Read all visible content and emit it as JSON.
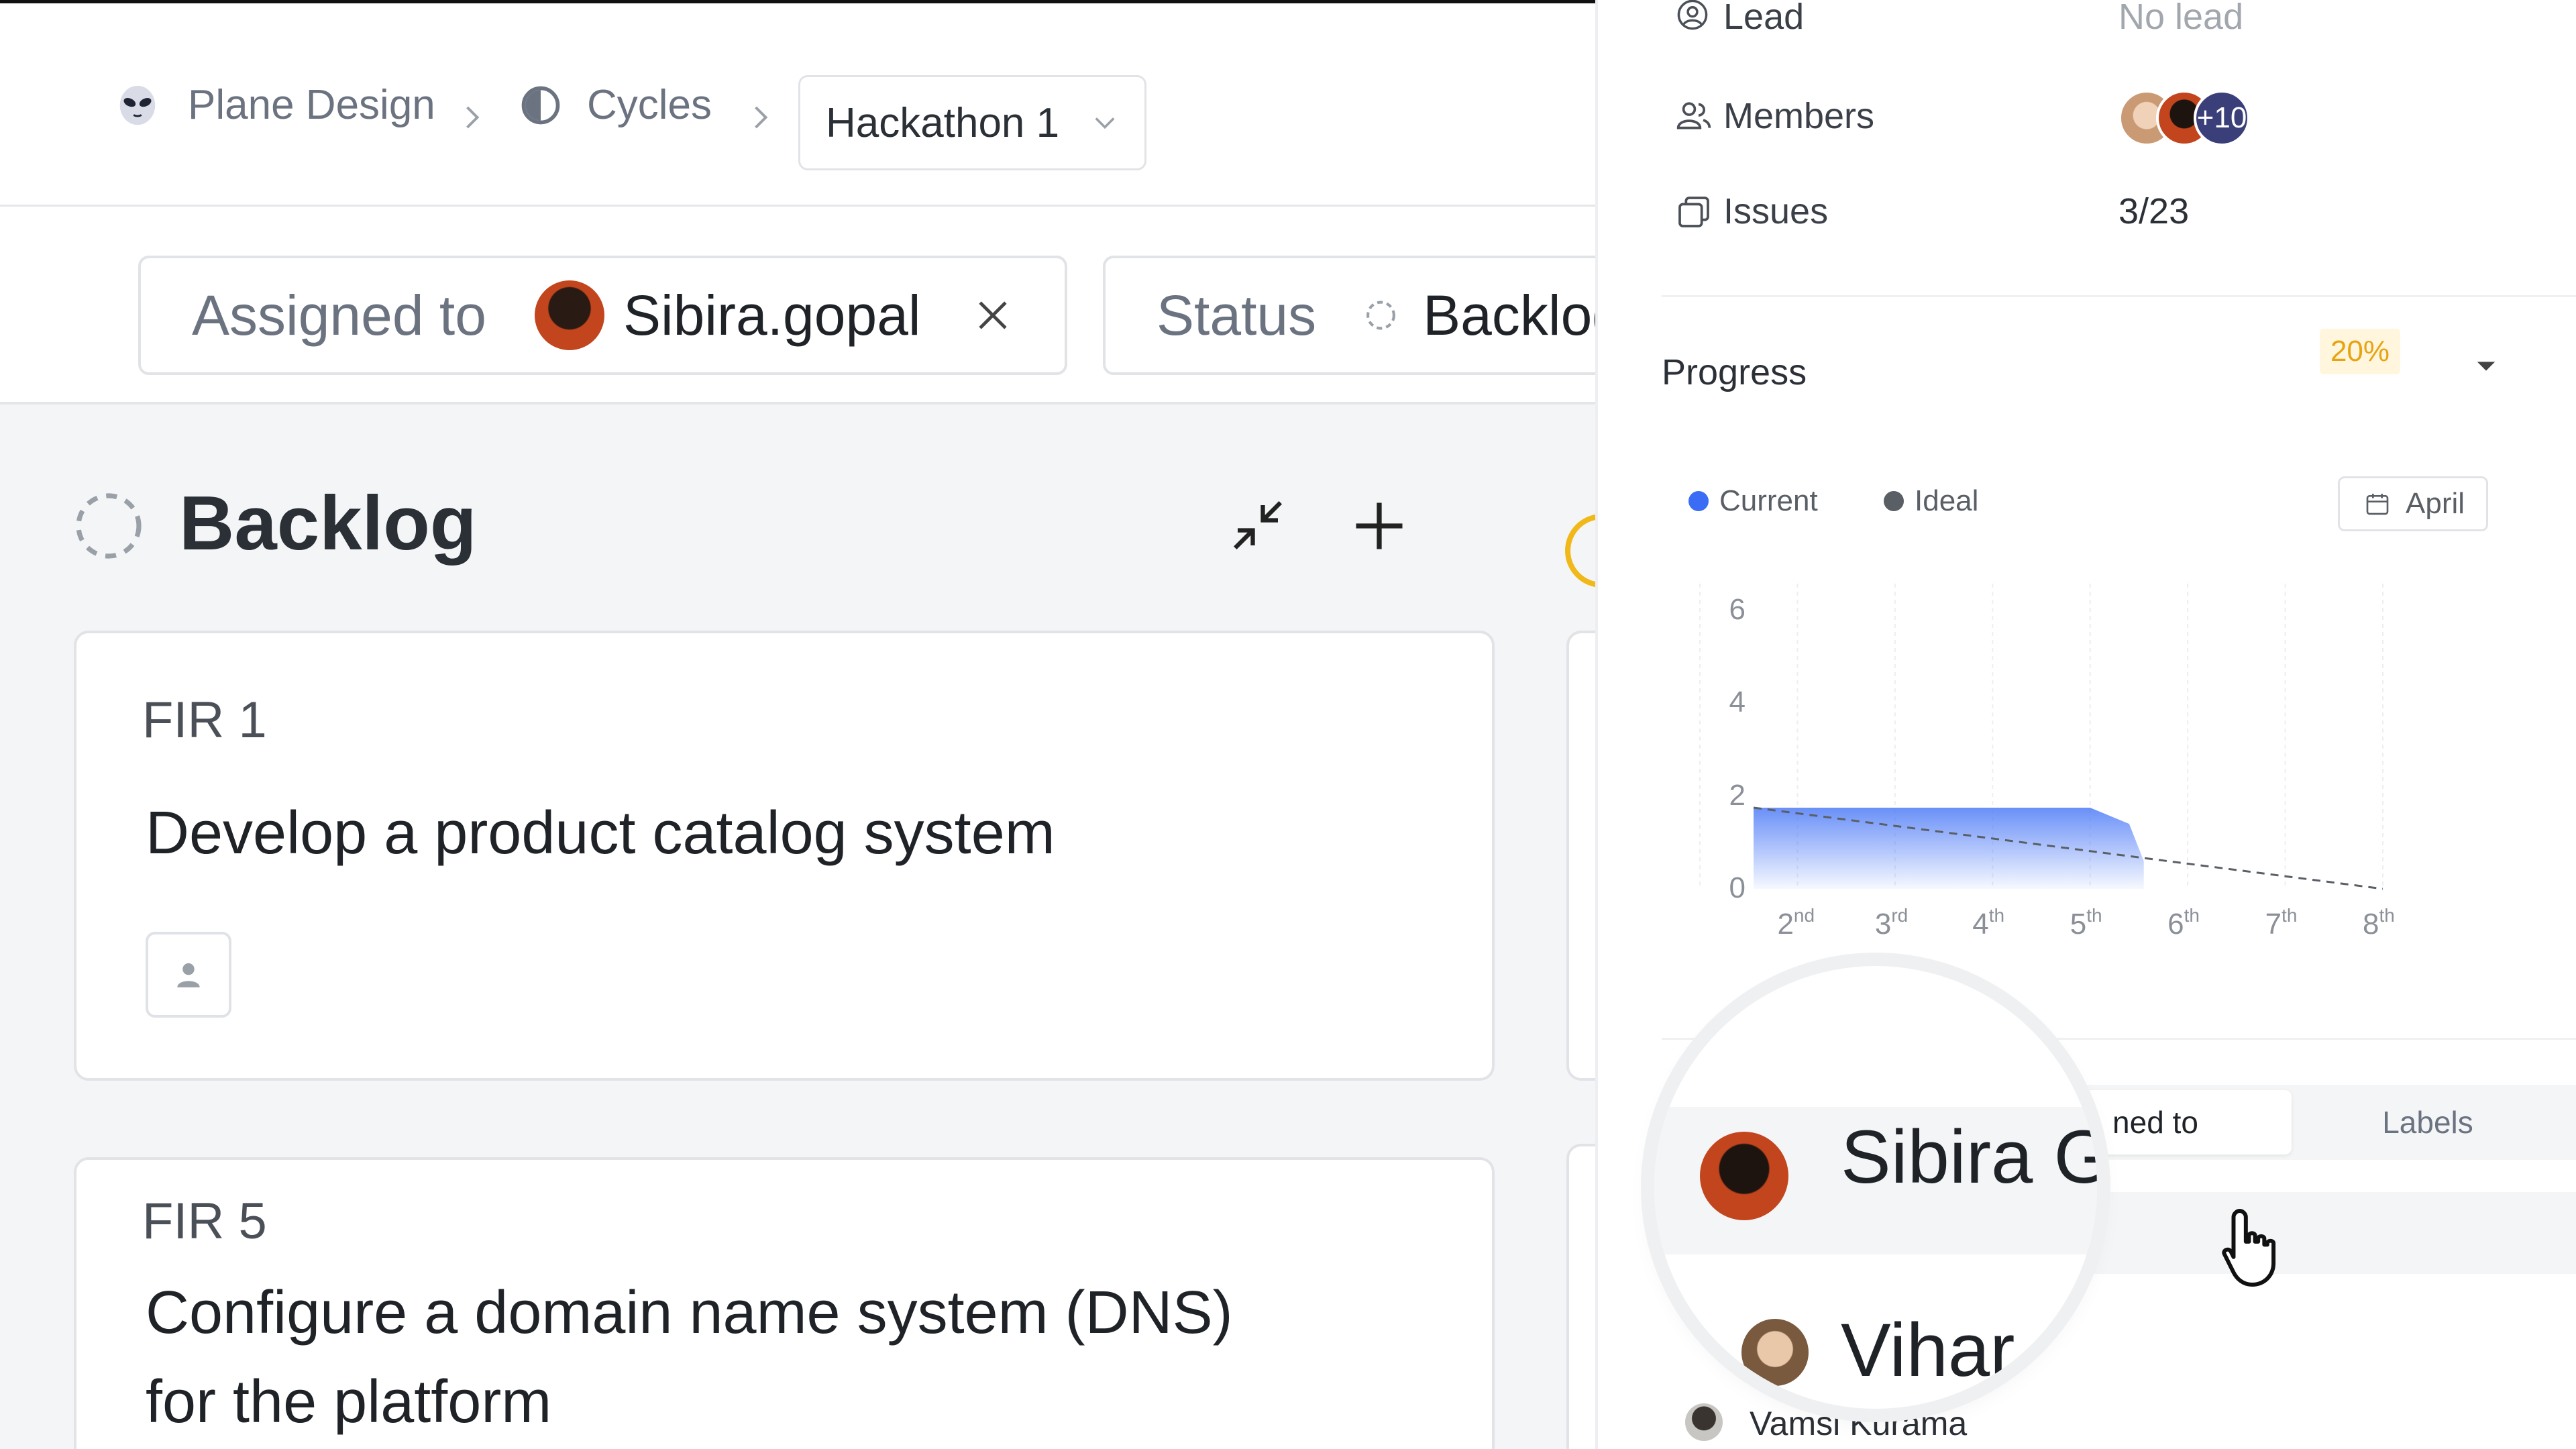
{
  "breadcrumb": {
    "workspace": "Plane Design",
    "section": "Cycles",
    "cycle": "Hackathon 1"
  },
  "filters": {
    "assigned_label": "Assigned to",
    "assigned_value": "Sibira.gopal",
    "status_label": "Status",
    "status_value": "Backlog"
  },
  "board": {
    "group_title": "Backlog",
    "cards": [
      {
        "id": "FIR 1",
        "title": "Develop a product catalog system"
      },
      {
        "id": "FIR 5",
        "title_line1": "Configure a domain name system (DNS)",
        "title_line2": "for the platform"
      }
    ]
  },
  "panel": {
    "lead_label": "Lead",
    "lead_value": "No lead",
    "members_label": "Members",
    "members_extra": "+10",
    "issues_label": "Issues",
    "issues_value": "3/23",
    "progress_label": "Progress",
    "progress_percent": "20%",
    "month_button": "April",
    "tabs": {
      "assigned": "Assigned to",
      "assigned_visible": "ned to",
      "labels": "Labels"
    },
    "list": [
      {
        "name": "Sibira G"
      },
      {
        "name": "Vihar"
      },
      {
        "name": "Vamsi Kurama"
      }
    ]
  },
  "colors": {
    "accent_blue": "#3b6cf6",
    "ideal_gray": "#5a5f66",
    "percent_amber": "#e8a312",
    "percent_bg": "#fff6dd"
  },
  "chart_data": {
    "type": "area",
    "title": "",
    "legend": [
      "Current",
      "Ideal"
    ],
    "x": [
      "2nd",
      "3rd",
      "4th",
      "5th",
      "6th",
      "7th",
      "8th"
    ],
    "y_ticks": [
      "0",
      "2",
      "4",
      "6"
    ],
    "ylim": [
      0,
      6
    ],
    "series": [
      {
        "name": "Current",
        "x": [
          1.55,
          2,
          3,
          4,
          5,
          5.4,
          5.55
        ],
        "values": [
          1.75,
          1.75,
          1.75,
          1.75,
          1.75,
          1.4,
          0.6
        ]
      },
      {
        "name": "Ideal",
        "x": [
          1.55,
          8
        ],
        "values": [
          1.75,
          0
        ]
      }
    ],
    "grid": true,
    "legend_position": "top-left"
  }
}
